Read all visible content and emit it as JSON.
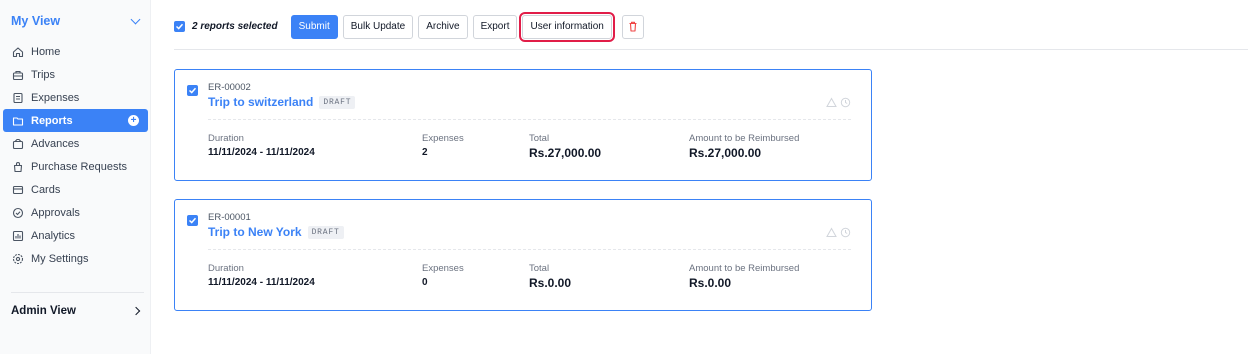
{
  "sidebar": {
    "header": "My View",
    "items": [
      {
        "label": "Home",
        "icon": "home-icon"
      },
      {
        "label": "Trips",
        "icon": "trips-icon"
      },
      {
        "label": "Expenses",
        "icon": "expenses-icon"
      },
      {
        "label": "Reports",
        "icon": "reports-icon",
        "active": true
      },
      {
        "label": "Advances",
        "icon": "advances-icon"
      },
      {
        "label": "Purchase Requests",
        "icon": "purchase-requests-icon"
      },
      {
        "label": "Cards",
        "icon": "cards-icon"
      },
      {
        "label": "Approvals",
        "icon": "approvals-icon"
      },
      {
        "label": "Analytics",
        "icon": "analytics-icon"
      },
      {
        "label": "My Settings",
        "icon": "settings-icon"
      }
    ],
    "admin": "Admin View"
  },
  "toolbar": {
    "selected_text": "2 reports selected",
    "submit": "Submit",
    "bulk_update": "Bulk Update",
    "archive": "Archive",
    "export": "Export",
    "user_information": "User information"
  },
  "reports": [
    {
      "id": "ER-00002",
      "title": "Trip to switzerland",
      "status": "DRAFT",
      "duration_label": "Duration",
      "duration": "11/11/2024 - 11/11/2024",
      "expenses_label": "Expenses",
      "expenses": "2",
      "total_label": "Total",
      "total": "Rs.27,000.00",
      "reimb_label": "Amount to be Reimbursed",
      "reimb": "Rs.27,000.00"
    },
    {
      "id": "ER-00001",
      "title": "Trip to New York",
      "status": "DRAFT",
      "duration_label": "Duration",
      "duration": "11/11/2024 - 11/11/2024",
      "expenses_label": "Expenses",
      "expenses": "0",
      "total_label": "Total",
      "total": "Rs.0.00",
      "reimb_label": "Amount to be Reimbursed",
      "reimb": "Rs.0.00"
    }
  ],
  "colors": {
    "accent": "#3b82f6",
    "highlight": "#e11d48",
    "delete": "#ef4444"
  }
}
